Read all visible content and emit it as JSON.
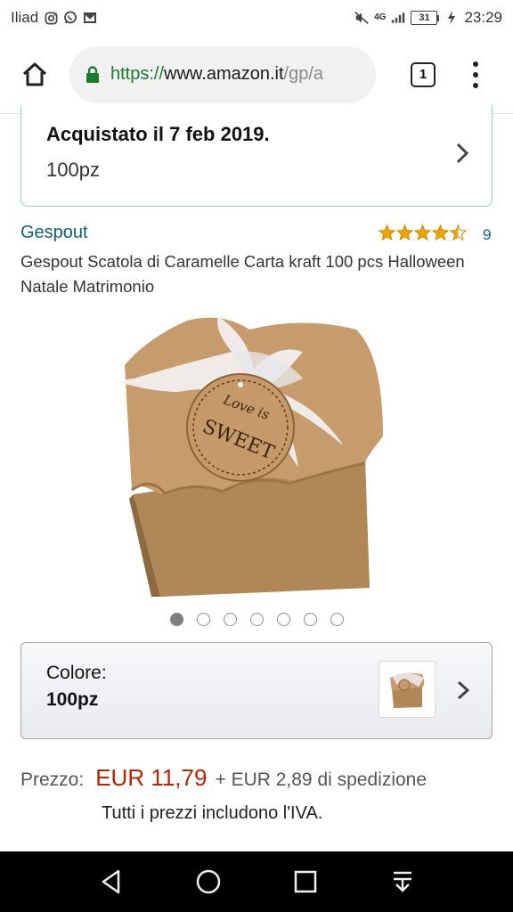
{
  "status_bar": {
    "carrier": "Iliad",
    "network_label": "4G",
    "battery_level": "31",
    "time": "23:29",
    "left_icons": [
      "instagram-icon",
      "whatsapp-icon",
      "gmail-icon"
    ],
    "right_icons": [
      "mute-icon",
      "signal-icon",
      "battery-icon",
      "charging-icon"
    ]
  },
  "browser": {
    "url_scheme": "https://",
    "url_host": "www.amazon.it",
    "url_path": "/gp/a",
    "tab_count": "1",
    "secure_color": "#1a7a2e"
  },
  "purchased": {
    "title": "Acquistato il 7 feb 2019.",
    "variant": "100pz"
  },
  "product": {
    "brand": "Gespout",
    "rating_stars": 4.5,
    "rating_count": "9",
    "title": "Gespout Scatola di Caramelle Carta kraft 100 pcs Halloween Natale Matrimonio",
    "tag_text_1": "Love is",
    "tag_text_2": "SWEET",
    "image_count": 7,
    "active_image_index": 0
  },
  "color_selector": {
    "label": "Colore:",
    "value": "100pz"
  },
  "price": {
    "label": "Prezzo:",
    "value": "EUR 11,79",
    "shipping": "+ EUR 2,89 di spedizione",
    "vat_note": "Tutti i prezzi includono l'IVA.",
    "price_color": "#b12704"
  },
  "nav_bar": {
    "buttons": [
      "back-icon",
      "home-circle-icon",
      "recents-icon",
      "notification-pulldown-icon"
    ]
  }
}
